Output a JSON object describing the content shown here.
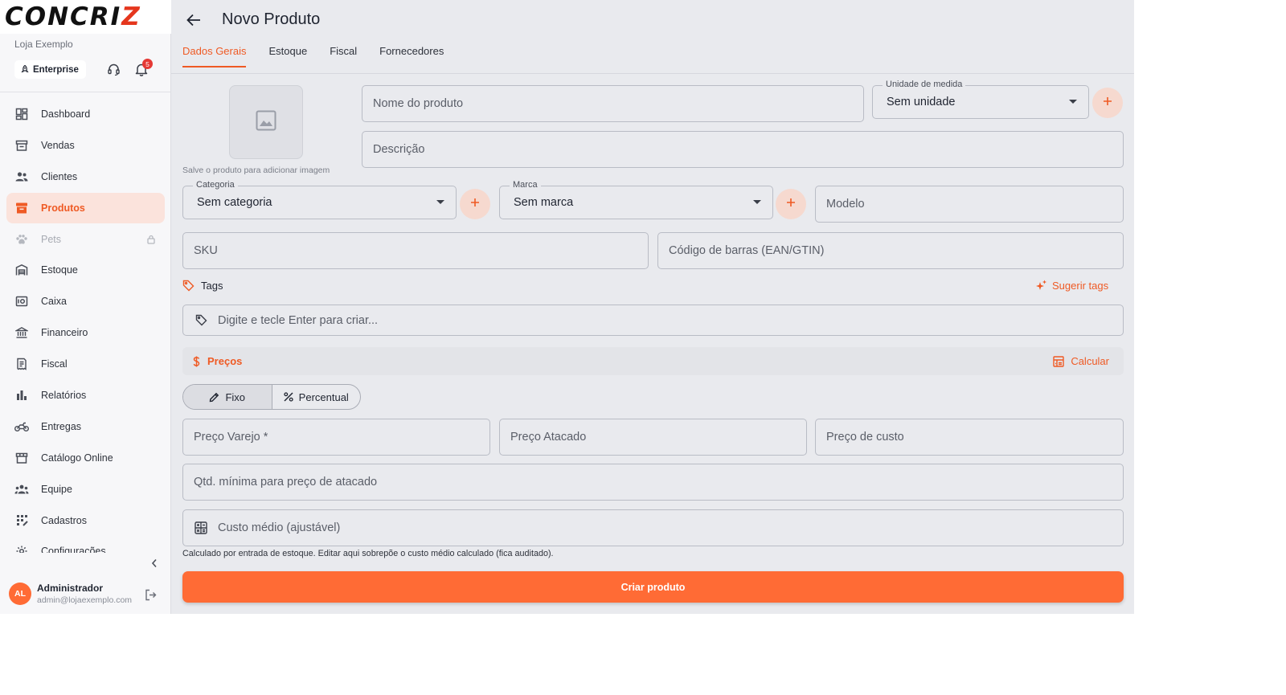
{
  "brand": {
    "logo_main": "CONCRI",
    "logo_accent": "Z",
    "store_name": "Loja Exemplo",
    "plan": "Enterprise",
    "notification_count": "5"
  },
  "sidebar": {
    "items": [
      {
        "label": "Dashboard",
        "icon": "dashboard-icon"
      },
      {
        "label": "Vendas",
        "icon": "storefront-icon"
      },
      {
        "label": "Clientes",
        "icon": "people-icon"
      },
      {
        "label": "Produtos",
        "icon": "inventory-box-icon",
        "active": true
      },
      {
        "label": "Pets",
        "icon": "paw-icon",
        "disabled": true
      },
      {
        "label": "Estoque",
        "icon": "warehouse-icon"
      },
      {
        "label": "Caixa",
        "icon": "cash-register-icon"
      },
      {
        "label": "Financeiro",
        "icon": "bank-icon"
      },
      {
        "label": "Fiscal",
        "icon": "receipt-icon"
      },
      {
        "label": "Relatórios",
        "icon": "bar-chart-icon"
      },
      {
        "label": "Entregas",
        "icon": "motorcycle-icon"
      },
      {
        "label": "Catálogo Online",
        "icon": "store-icon"
      },
      {
        "label": "Equipe",
        "icon": "team-icon"
      },
      {
        "label": "Cadastros",
        "icon": "list-grid-icon"
      },
      {
        "label": "Configurações",
        "icon": "gear-icon"
      }
    ]
  },
  "user": {
    "initials": "AL",
    "name": "Administrador",
    "email": "admin@lojaexemplo.com"
  },
  "header": {
    "title": "Novo Produto"
  },
  "tabs": [
    "Dados Gerais",
    "Estoque",
    "Fiscal",
    "Fornecedores"
  ],
  "form": {
    "image_hint": "Salve o produto para adicionar imagem",
    "product_name_placeholder": "Nome do produto",
    "unit_label": "Unidade de medida",
    "unit_value": "Sem unidade",
    "description_placeholder": "Descrição",
    "category_label": "Categoria",
    "category_value": "Sem categoria",
    "brand_label": "Marca",
    "brand_value": "Sem marca",
    "model_placeholder": "Modelo",
    "sku_placeholder": "SKU",
    "barcode_placeholder": "Código de barras (EAN/GTIN)",
    "tags_label": "Tags",
    "suggest_tags": "Sugerir tags",
    "tags_placeholder": "Digite e tecle Enter para criar..."
  },
  "prices": {
    "section_title": "Preços",
    "calculate_label": "Calcular",
    "mode_fixed": "Fixo",
    "mode_percent": "Percentual",
    "retail_placeholder": "Preço Varejo *",
    "wholesale_placeholder": "Preço Atacado",
    "cost_placeholder": "Preço de custo",
    "min_wholesale_qty_placeholder": "Qtd. mínima para preço de atacado",
    "avg_cost_placeholder": "Custo médio (ajustável)",
    "avg_cost_hint": "Calculado por entrada de estoque. Editar aqui sobrepõe o custo médio calculado (fica auditado)."
  },
  "actions": {
    "create": "Criar produto"
  },
  "colors": {
    "accent": "#ff6b35",
    "accent_text": "#ef5a24",
    "active_bg": "#fbe3dc",
    "main_bg": "#e9eaee",
    "sidebar_bg": "#f7f7f9"
  }
}
